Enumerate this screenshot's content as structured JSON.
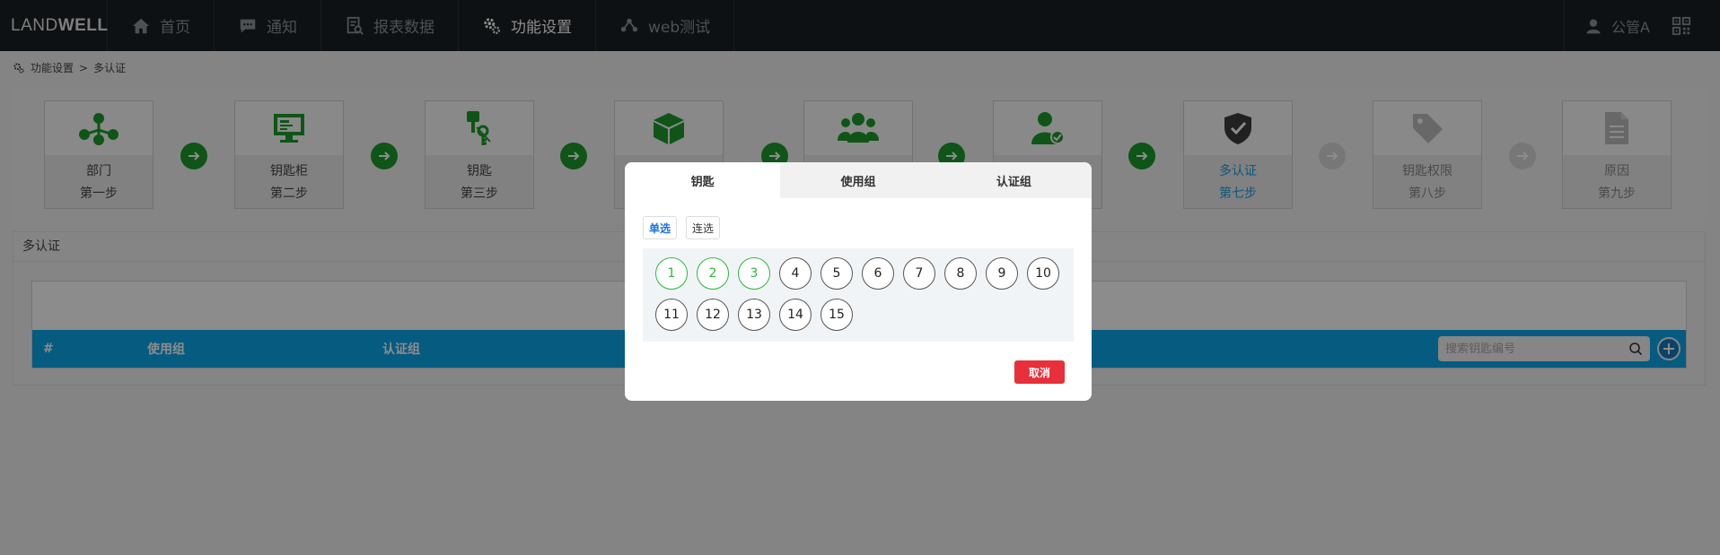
{
  "brand": {
    "prefix": "LAND",
    "suffix": "WELL"
  },
  "nav": {
    "items": [
      {
        "label": "首页",
        "icon": "home-icon"
      },
      {
        "label": "通知",
        "icon": "chat-icon"
      },
      {
        "label": "报表数据",
        "icon": "report-icon"
      },
      {
        "label": "功能设置",
        "icon": "gear-icon",
        "active": true
      },
      {
        "label": "web测试",
        "icon": "network-icon"
      }
    ],
    "user": "公管A"
  },
  "breadcrumb": {
    "parent": "功能设置",
    "separator": ">",
    "current": "多认证"
  },
  "steps": [
    {
      "name": "部门",
      "step": "第一步",
      "icon": "org-icon"
    },
    {
      "name": "钥匙柜",
      "step": "第二步",
      "icon": "cabinet-icon"
    },
    {
      "name": "钥匙",
      "step": "第三步",
      "icon": "key-icon"
    },
    {
      "name": "",
      "step": "",
      "icon": "cube-icon"
    },
    {
      "name": "",
      "step": "",
      "icon": "users-icon"
    },
    {
      "name": "",
      "step": "",
      "icon": "user-check-icon"
    },
    {
      "name": "多认证",
      "step": "第七步",
      "icon": "shield-icon"
    },
    {
      "name": "钥匙权限",
      "step": "第八步",
      "icon": "tag-icon"
    },
    {
      "name": "原因",
      "step": "第九步",
      "icon": "document-icon"
    }
  ],
  "content": {
    "title": "多认证",
    "columns": [
      "#",
      "使用组",
      "认证组"
    ],
    "search_placeholder": "搜索钥匙编号"
  },
  "modal": {
    "tabs": [
      "钥匙",
      "使用组",
      "认证组"
    ],
    "active_tab": 0,
    "modes": [
      "单选",
      "连选"
    ],
    "active_mode": 0,
    "keys": [
      "1",
      "2",
      "3",
      "4",
      "5",
      "6",
      "7",
      "8",
      "9",
      "10",
      "11",
      "12",
      "13",
      "14",
      "15"
    ],
    "selected_keys": [
      "1",
      "2",
      "3"
    ],
    "cancel_label": "取消"
  },
  "colors": {
    "topbar": "#1b1f24",
    "step_icon_green": "#1a9c2a",
    "current_step": "#1aa0dc",
    "table_header": "#0ca6ea",
    "selected_key": "#2bb83a",
    "cancel": "#e7303a"
  }
}
